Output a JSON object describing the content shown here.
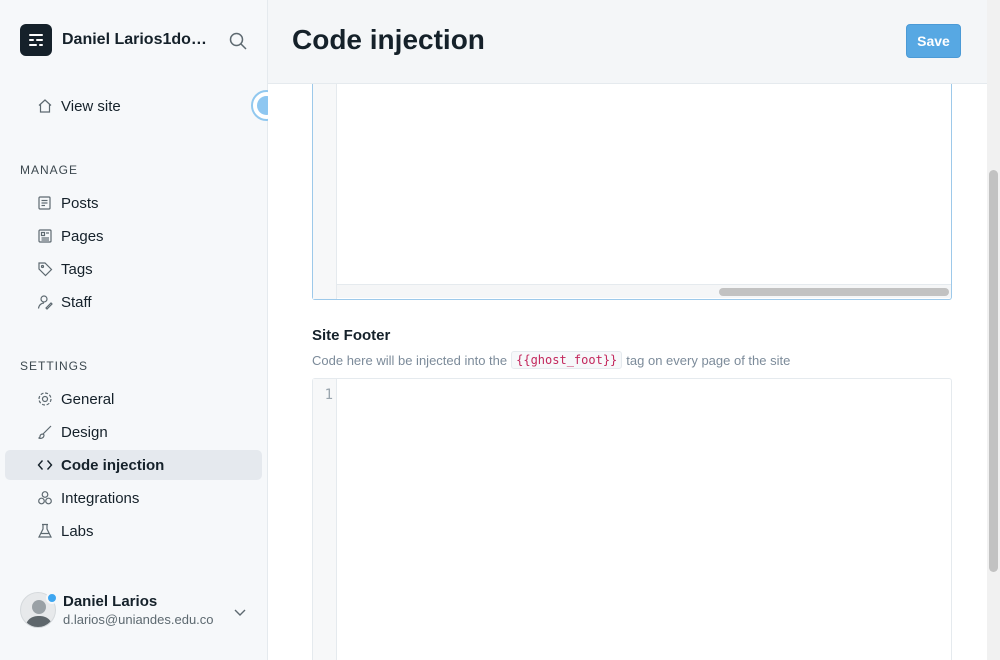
{
  "sidebar": {
    "brand_name": "Daniel Larios1dolarx...",
    "top_items": [
      {
        "label": "View site",
        "icon": "home-icon"
      }
    ],
    "manage_label": "MANAGE",
    "manage_items": [
      {
        "label": "Posts",
        "icon": "posts-icon"
      },
      {
        "label": "Pages",
        "icon": "pages-icon"
      },
      {
        "label": "Tags",
        "icon": "tag-icon"
      },
      {
        "label": "Staff",
        "icon": "staff-icon"
      }
    ],
    "settings_label": "SETTINGS",
    "settings_items": [
      {
        "label": "General",
        "icon": "gear-icon"
      },
      {
        "label": "Design",
        "icon": "brush-icon"
      },
      {
        "label": "Code injection",
        "icon": "code-icon",
        "active": true
      },
      {
        "label": "Integrations",
        "icon": "integrations-icon"
      },
      {
        "label": "Labs",
        "icon": "flask-icon"
      }
    ],
    "user": {
      "name": "Daniel Larios",
      "email": "d.larios@uniandes.edu.co"
    }
  },
  "header": {
    "title": "Code injection",
    "save_label": "Save"
  },
  "footer_section": {
    "label": "Site Footer",
    "desc_before": "Code here will be injected into the",
    "code_tag": "{{ghost_foot}}",
    "desc_after": "tag on every page of the site",
    "line_number": "1"
  },
  "colors": {
    "accent": "#57a8e3",
    "active_bg": "#e5e9ee"
  }
}
